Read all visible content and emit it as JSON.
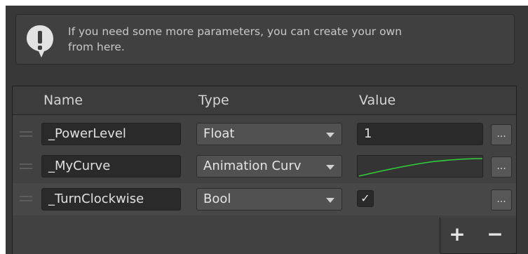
{
  "help": {
    "icon": "warning-icon",
    "text_line1": "If you need some more parameters, you can create your own",
    "text_line2": "from here."
  },
  "list": {
    "headers": {
      "name": "Name",
      "type": "Type",
      "value": "Value"
    },
    "rows": [
      {
        "name": "_PowerLevel",
        "type": "Float",
        "value": "1",
        "more_label": "..."
      },
      {
        "name": "_MyCurve",
        "type": "Animation Curv",
        "value_kind": "animation-curve",
        "more_label": "..."
      },
      {
        "name": "_TurnClockwise",
        "type": "Bool",
        "value": "✓",
        "value_checked": true,
        "more_label": "..."
      }
    ]
  },
  "footer": {
    "add_label": "+",
    "remove_label": "−"
  },
  "colors": {
    "curve": "#2fd13a",
    "background": "#383838",
    "field": "#2a2a2a"
  }
}
